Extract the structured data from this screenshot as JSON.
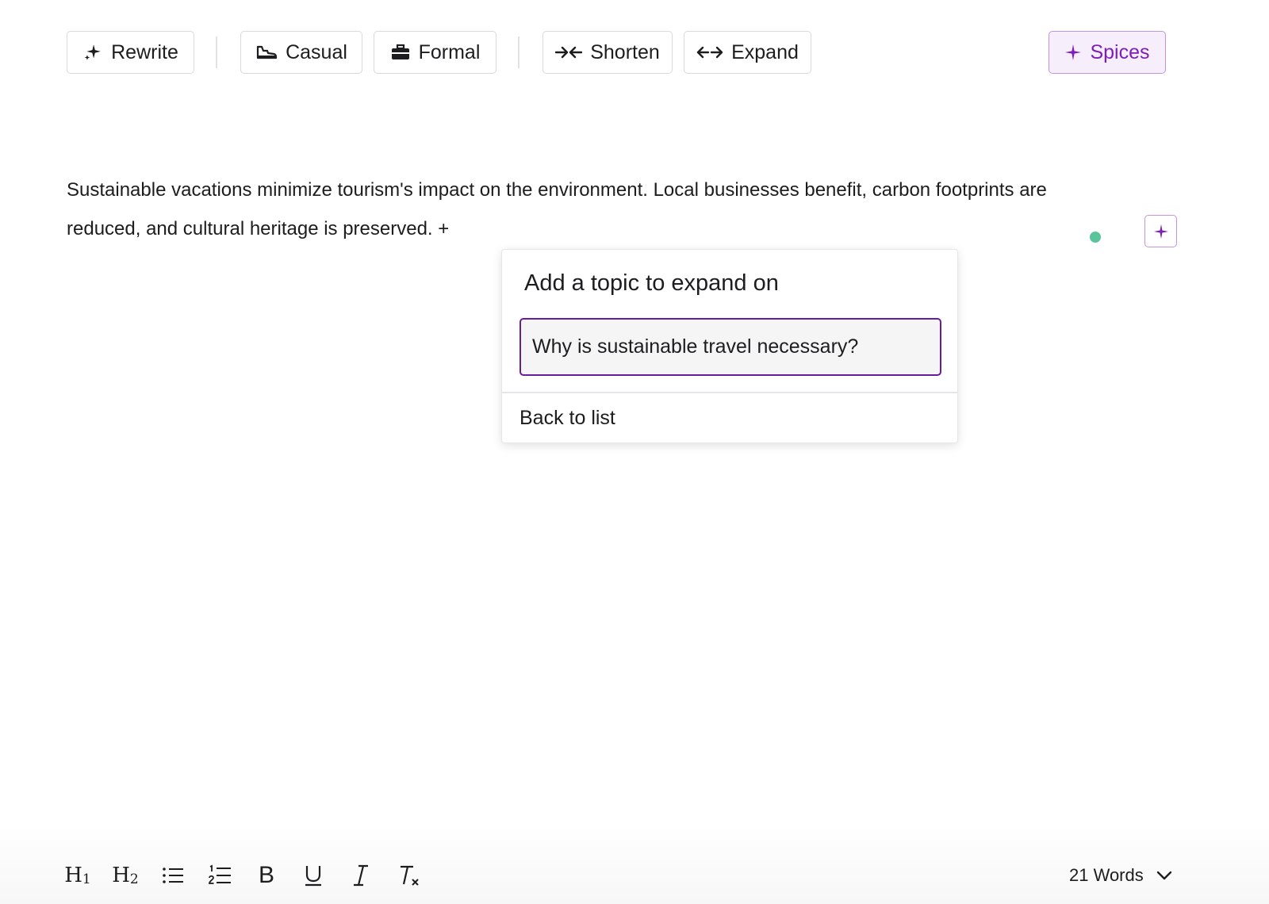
{
  "toolbar": {
    "rewrite_label": "Rewrite",
    "casual_label": "Casual",
    "formal_label": "Formal",
    "shorten_label": "Shorten",
    "expand_label": "Expand",
    "spices_label": "Spices"
  },
  "editor": {
    "paragraph": "Sustainable vacations minimize tourism's impact on the environment. Local businesses benefit, carbon footprints are reduced, and cultural heritage is preserved.",
    "inline_add": "+"
  },
  "popover": {
    "title": "Add a topic to expand on",
    "input_value": "Why is sustainable travel necessary?",
    "back_label": "Back to list"
  },
  "format_bar": {
    "word_count": "21 Words"
  },
  "colors": {
    "accent": "#7d1fb6",
    "accent_bg": "#f7eefc",
    "status_dot": "#5bc49a",
    "input_border": "#6a1b9a"
  },
  "icons": {
    "rewrite": "sparkle-icon",
    "casual": "sneaker-icon",
    "formal": "briefcase-icon",
    "shorten": "arrows-inward-icon",
    "expand": "arrows-outward-icon",
    "spices": "plus-sparkle-icon",
    "word_count_toggle": "chevron-down-icon"
  }
}
